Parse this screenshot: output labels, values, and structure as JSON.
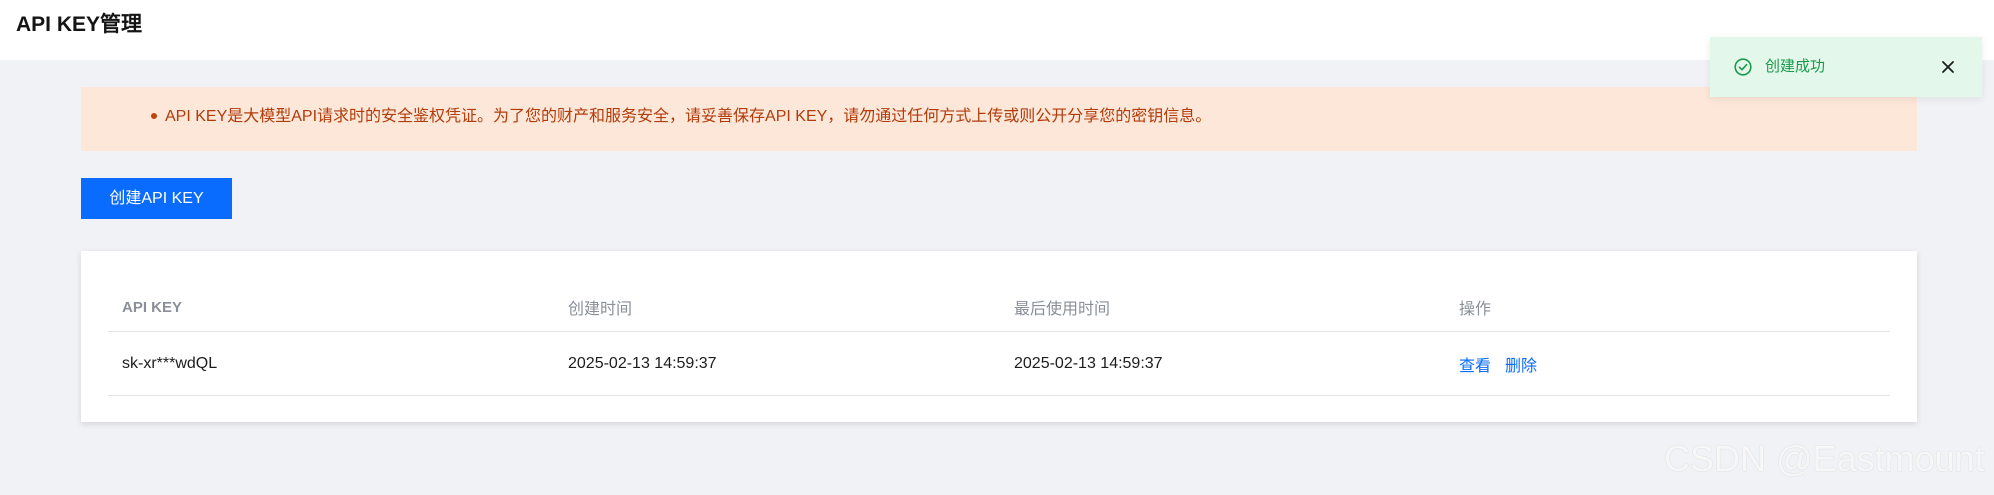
{
  "header": {
    "title": "API KEY管理"
  },
  "notice": {
    "text": "API KEY是大模型API请求时的安全鉴权凭证。为了您的财产和服务安全，请妥善保存API KEY，请勿通过任何方式上传或则公开分享您的密钥信息。"
  },
  "create_button": {
    "label": "创建API KEY"
  },
  "table": {
    "columns": [
      "API KEY",
      "创建时间",
      "最后使用时间",
      "操作"
    ],
    "rows": [
      {
        "key": "sk-xr***wdQL",
        "created": "2025-02-13 14:59:37",
        "last_used": "2025-02-13 14:59:37",
        "actions": [
          "查看",
          "删除"
        ]
      }
    ]
  },
  "toast": {
    "icon": "check-circle-icon",
    "text": "创建成功",
    "close_icon": "close-icon"
  },
  "watermark": {
    "text": "CSDN @Eastmount"
  },
  "colors": {
    "accent": "#0a6cff",
    "notice_bg": "#fde7d9",
    "notice_text": "#b23b0a",
    "success_bg": "#e3f8ea",
    "success_text": "#1a9a4a",
    "page_bg": "#f1f2f5"
  }
}
